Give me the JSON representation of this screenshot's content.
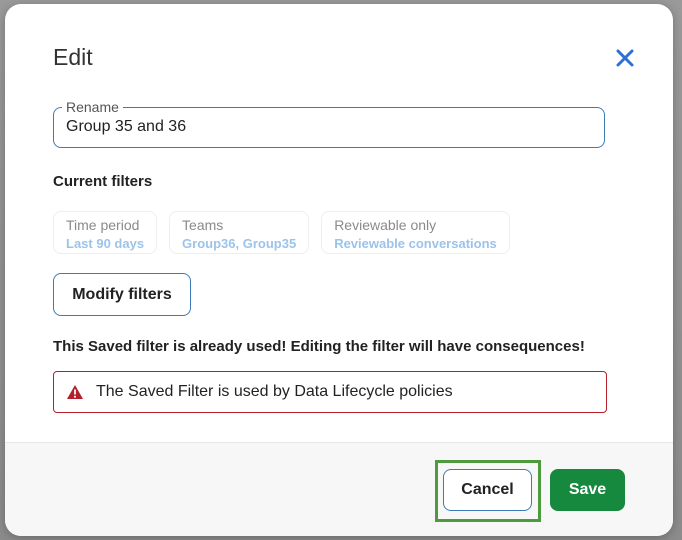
{
  "dialog": {
    "title": "Edit",
    "close_icon": "close-icon"
  },
  "rename": {
    "label": "Rename",
    "value": "Group 35 and 36"
  },
  "filters": {
    "section_title": "Current filters",
    "items": [
      {
        "label": "Time period",
        "value": "Last 90 days"
      },
      {
        "label": "Teams",
        "value": "Group36, Group35"
      },
      {
        "label": "Reviewable only",
        "value": "Reviewable conversations"
      }
    ],
    "modify_label": "Modify filters"
  },
  "warning": {
    "message": "This Saved filter is already used! Editing the filter will have consequences!",
    "alert_text": "The Saved Filter is used by Data Lifecycle policies",
    "alert_icon": "warning-icon"
  },
  "footer": {
    "cancel_label": "Cancel",
    "save_label": "Save"
  },
  "colors": {
    "accent": "#3d7ab8",
    "close": "#2e6fd6",
    "save": "#17893e",
    "alert": "#b3202a",
    "highlight": "#4e9a3e"
  }
}
